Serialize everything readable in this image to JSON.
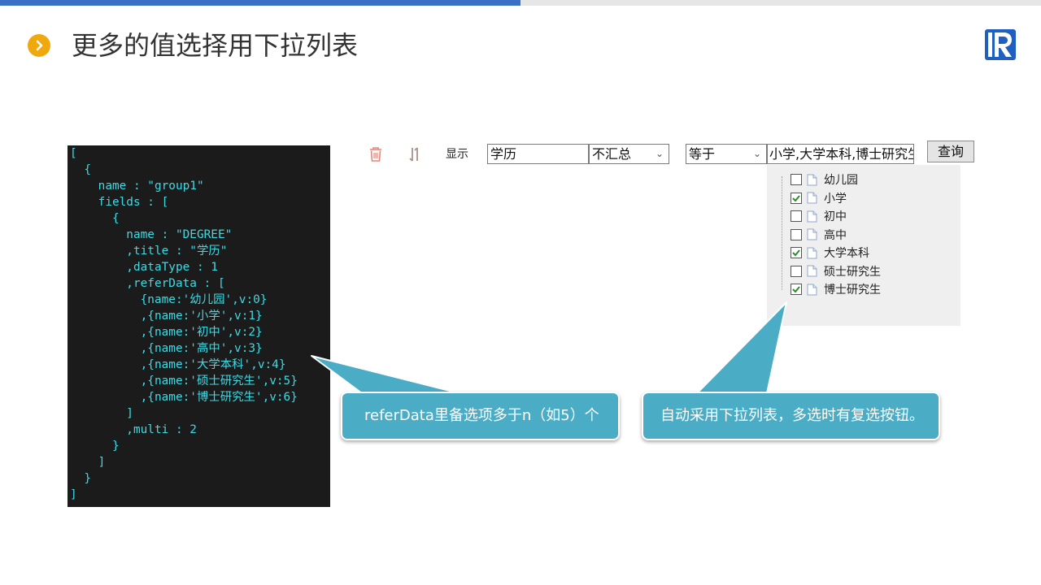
{
  "header": {
    "title": "更多的值选择用下拉列表",
    "bullet_icon": "chevron-right-icon",
    "logo_icon": "runqian-logo-icon",
    "bar_colors": {
      "blue": "#3a6fc4",
      "gray": "#e6e6e6"
    }
  },
  "code_panel": {
    "lines": [
      "[",
      "  {",
      "    name : \"group1\"",
      "    fields : [",
      "      {",
      "        name : \"DEGREE\"",
      "        ,title : \"学历\"",
      "        ,dataType : 1",
      "        ,referData : [",
      "          {name:'幼儿园',v:0}",
      "          ,{name:'小学',v:1}",
      "          ,{name:'初中',v:2}",
      "          ,{name:'高中',v:3}",
      "          ,{name:'大学本科',v:4}",
      "          ,{name:'硕士研究生',v:5}",
      "          ,{name:'博士研究生',v:6}",
      "        ]",
      "        ,multi : 2",
      "      }",
      "    ]",
      "  }",
      "]"
    ]
  },
  "toolbar": {
    "delete_icon": "trash-icon",
    "sort_icon": "sort-arrows-icon",
    "show_label": "显示",
    "field_value": "学历",
    "aggregate_value": "不汇总",
    "operator_value": "等于",
    "value_text": "小学,大学本科,博士研究生",
    "query_label": "查询"
  },
  "dropdown": {
    "items": [
      {
        "label": "幼儿园",
        "checked": false
      },
      {
        "label": "小学",
        "checked": true
      },
      {
        "label": "初中",
        "checked": false
      },
      {
        "label": "高中",
        "checked": false
      },
      {
        "label": "大学本科",
        "checked": true
      },
      {
        "label": "硕士研究生",
        "checked": false
      },
      {
        "label": "博士研究生",
        "checked": true
      }
    ]
  },
  "callouts": {
    "left": "referData里备选项多于n（如5）个",
    "right": "自动采用下拉列表，多选时有复选按钮。",
    "color": "#4bacc6"
  }
}
